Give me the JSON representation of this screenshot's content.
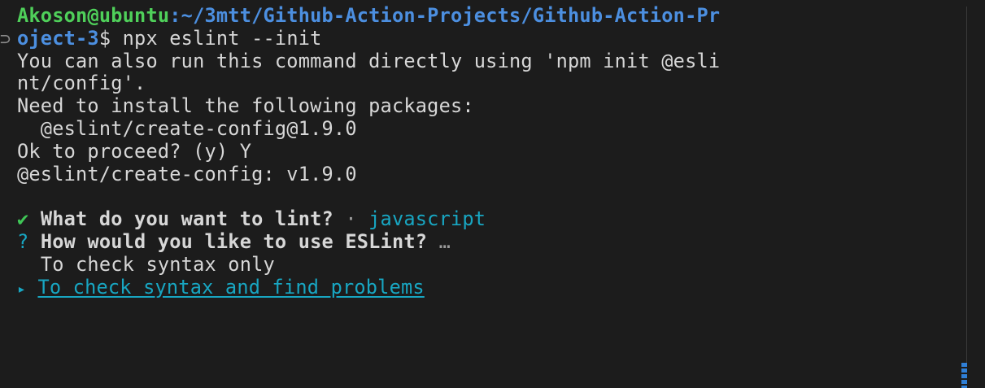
{
  "terminal": {
    "prompt_user": "Akoson@ubuntu",
    "prompt_path_line1": ":~/3mtt/Github-Action-Projects/Github-Action-Pr",
    "prompt_path_line2": "oject-3",
    "prompt_symbol": "$ ",
    "command": "npx eslint --init",
    "output_lines": [
      "You can also run this command directly using 'npm init @esli",
      "nt/config'.",
      "Need to install the following packages:",
      "  @eslint/create-config@1.9.0",
      "Ok to proceed? (y) Y",
      "@eslint/create-config: v1.9.0"
    ],
    "question1": {
      "mark": "✔",
      "text": "What do you want to lint?",
      "separator": " · ",
      "answer": "javascript"
    },
    "question2": {
      "mark": "?",
      "text": "How would you like to use ESLint?",
      "ellipsis": " …"
    },
    "options": [
      {
        "pointer": " ",
        "label": "To check syntax only",
        "selected": false
      },
      {
        "pointer": "▸",
        "label": "To check syntax and find problems",
        "selected": true
      }
    ],
    "gutter_marker": "⊃"
  },
  "colors": {
    "background": "#1c1c1c",
    "text": "#d7d7d7",
    "user": "#4fd05a",
    "path": "#4c8fe0",
    "accent_cyan": "#18a6c2",
    "scroll_thumb": "#2f7fd6"
  }
}
